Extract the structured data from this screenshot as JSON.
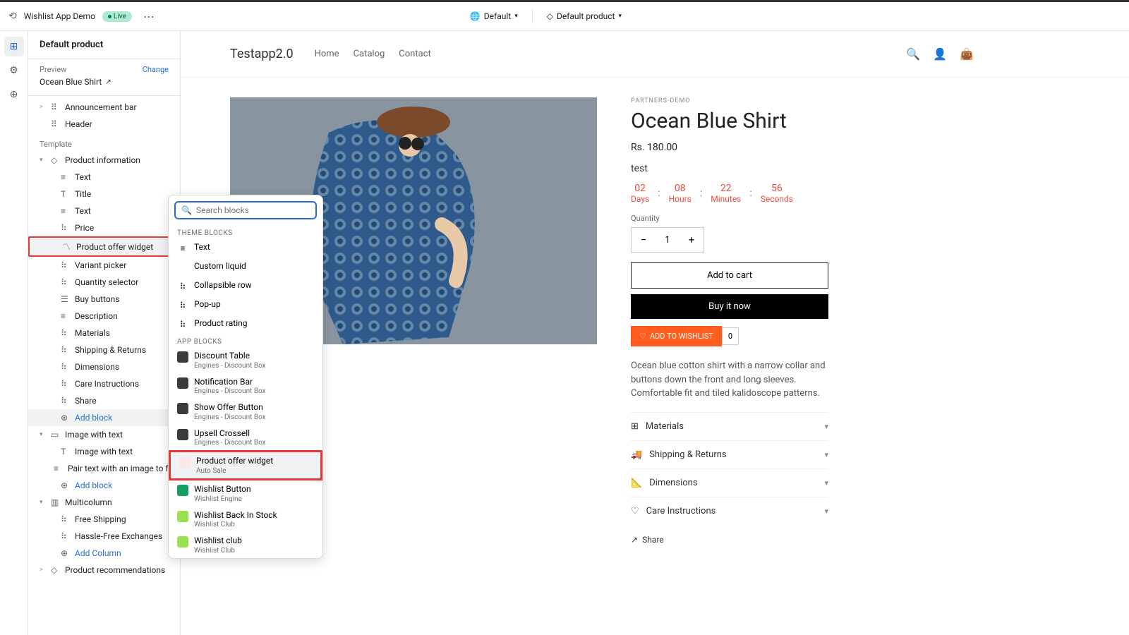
{
  "topbar": {
    "app_name": "Wishlist App Demo",
    "live_label": "Live",
    "locale_label": "Default",
    "template_label": "Default product"
  },
  "leftpanel": {
    "title": "Default product",
    "preview_label": "Preview",
    "change_label": "Change",
    "product_name": "Ocean Blue Shirt",
    "section_template": "Template",
    "sections_top": [
      {
        "icon": "⠿",
        "label": "Announcement bar",
        "chev": ">"
      },
      {
        "icon": "⠿",
        "label": "Header"
      }
    ],
    "product_info_label": "Product information",
    "blocks": [
      {
        "icon": "≡",
        "label": "Text"
      },
      {
        "icon": "T",
        "label": "Title"
      },
      {
        "icon": "≡",
        "label": "Text"
      },
      {
        "icon": "⠷",
        "label": "Price"
      },
      {
        "icon": "〽",
        "label": "Product offer widget",
        "selected": true,
        "highlight": true
      },
      {
        "icon": "⠷",
        "label": "Variant picker"
      },
      {
        "icon": "⠷",
        "label": "Quantity selector"
      },
      {
        "icon": "☰",
        "label": "Buy buttons"
      },
      {
        "icon": "≡",
        "label": "Description"
      },
      {
        "icon": "⠷",
        "label": "Materials"
      },
      {
        "icon": "⠷",
        "label": "Shipping & Returns"
      },
      {
        "icon": "⠷",
        "label": "Dimensions"
      },
      {
        "icon": "⠷",
        "label": "Care Instructions"
      },
      {
        "icon": "⠷",
        "label": "Share"
      }
    ],
    "add_block": "Add block",
    "image_text_label": "Image with text",
    "image_text_children": [
      {
        "icon": "T",
        "label": "Image with text"
      },
      {
        "icon": "≡",
        "label": "Pair text with an image to fo..."
      }
    ],
    "multicolumn_label": "Multicolumn",
    "multicolumn_children": [
      {
        "icon": "⠷",
        "label": "Free Shipping"
      },
      {
        "icon": "⠷",
        "label": "Hassle-Free Exchanges"
      }
    ],
    "add_column": "Add Column",
    "product_recs": "Product recommendations"
  },
  "popup": {
    "search_placeholder": "Search blocks",
    "theme_label": "THEME BLOCKS",
    "theme_blocks": [
      {
        "icon": "≡",
        "label": "Text"
      },
      {
        "icon": "</>",
        "label": "Custom liquid"
      },
      {
        "icon": "⠷",
        "label": "Collapsible row"
      },
      {
        "icon": "⠷",
        "label": "Pop-up"
      },
      {
        "icon": "⠷",
        "label": "Product rating"
      }
    ],
    "app_label": "APP BLOCKS",
    "app_blocks": [
      {
        "color": "#3b3b3b",
        "label": "Discount Table",
        "sub": "Engines - Discount Box"
      },
      {
        "color": "#3b3b3b",
        "label": "Notification Bar",
        "sub": "Engines - Discount Box"
      },
      {
        "color": "#3b3b3b",
        "label": "Show Offer Button",
        "sub": "Engines - Discount Box"
      },
      {
        "color": "#3b3b3b",
        "label": "Upsell Crossell",
        "sub": "Engines - Discount Box"
      },
      {
        "color": "#fde6e6",
        "label": "Product offer widget",
        "sub": "Auto Sale",
        "highlight": true,
        "hover": true
      },
      {
        "color": "#14a05e",
        "label": "Wishlist Button",
        "sub": "Wishlist Engine"
      },
      {
        "color": "#9be14f",
        "label": "Wishlist Back In Stock",
        "sub": "Wishlist Club"
      },
      {
        "color": "#9be14f",
        "label": "Wishlist club",
        "sub": "Wishlist Club"
      }
    ]
  },
  "store": {
    "name": "Testapp2.0",
    "nav": [
      "Home",
      "Catalog",
      "Contact"
    ],
    "vendor": "PARTNERS-DEMO",
    "product_title": "Ocean Blue Shirt",
    "price": "Rs. 180.00",
    "test_label": "test",
    "countdown": {
      "days": "02",
      "hours": "08",
      "minutes": "22",
      "seconds": "56",
      "d_label": "Days",
      "h_label": "Hours",
      "m_label": "Minutes",
      "s_label": "Seconds"
    },
    "qty_label": "Quantity",
    "qty_value": "1",
    "addcart": "Add to cart",
    "buynow": "Buy it now",
    "wishlist": "ADD TO WISHLIST",
    "wishlist_count": "0",
    "description": "Ocean blue cotton shirt with a narrow collar and buttons down the front and long sleeves. Comfortable fit and tiled kalidoscope patterns.",
    "accordion": [
      {
        "icon": "⊞",
        "label": "Materials"
      },
      {
        "icon": "🚚",
        "label": "Shipping & Returns"
      },
      {
        "icon": "📐",
        "label": "Dimensions"
      },
      {
        "icon": "♡",
        "label": "Care Instructions"
      }
    ],
    "share": "Share"
  }
}
